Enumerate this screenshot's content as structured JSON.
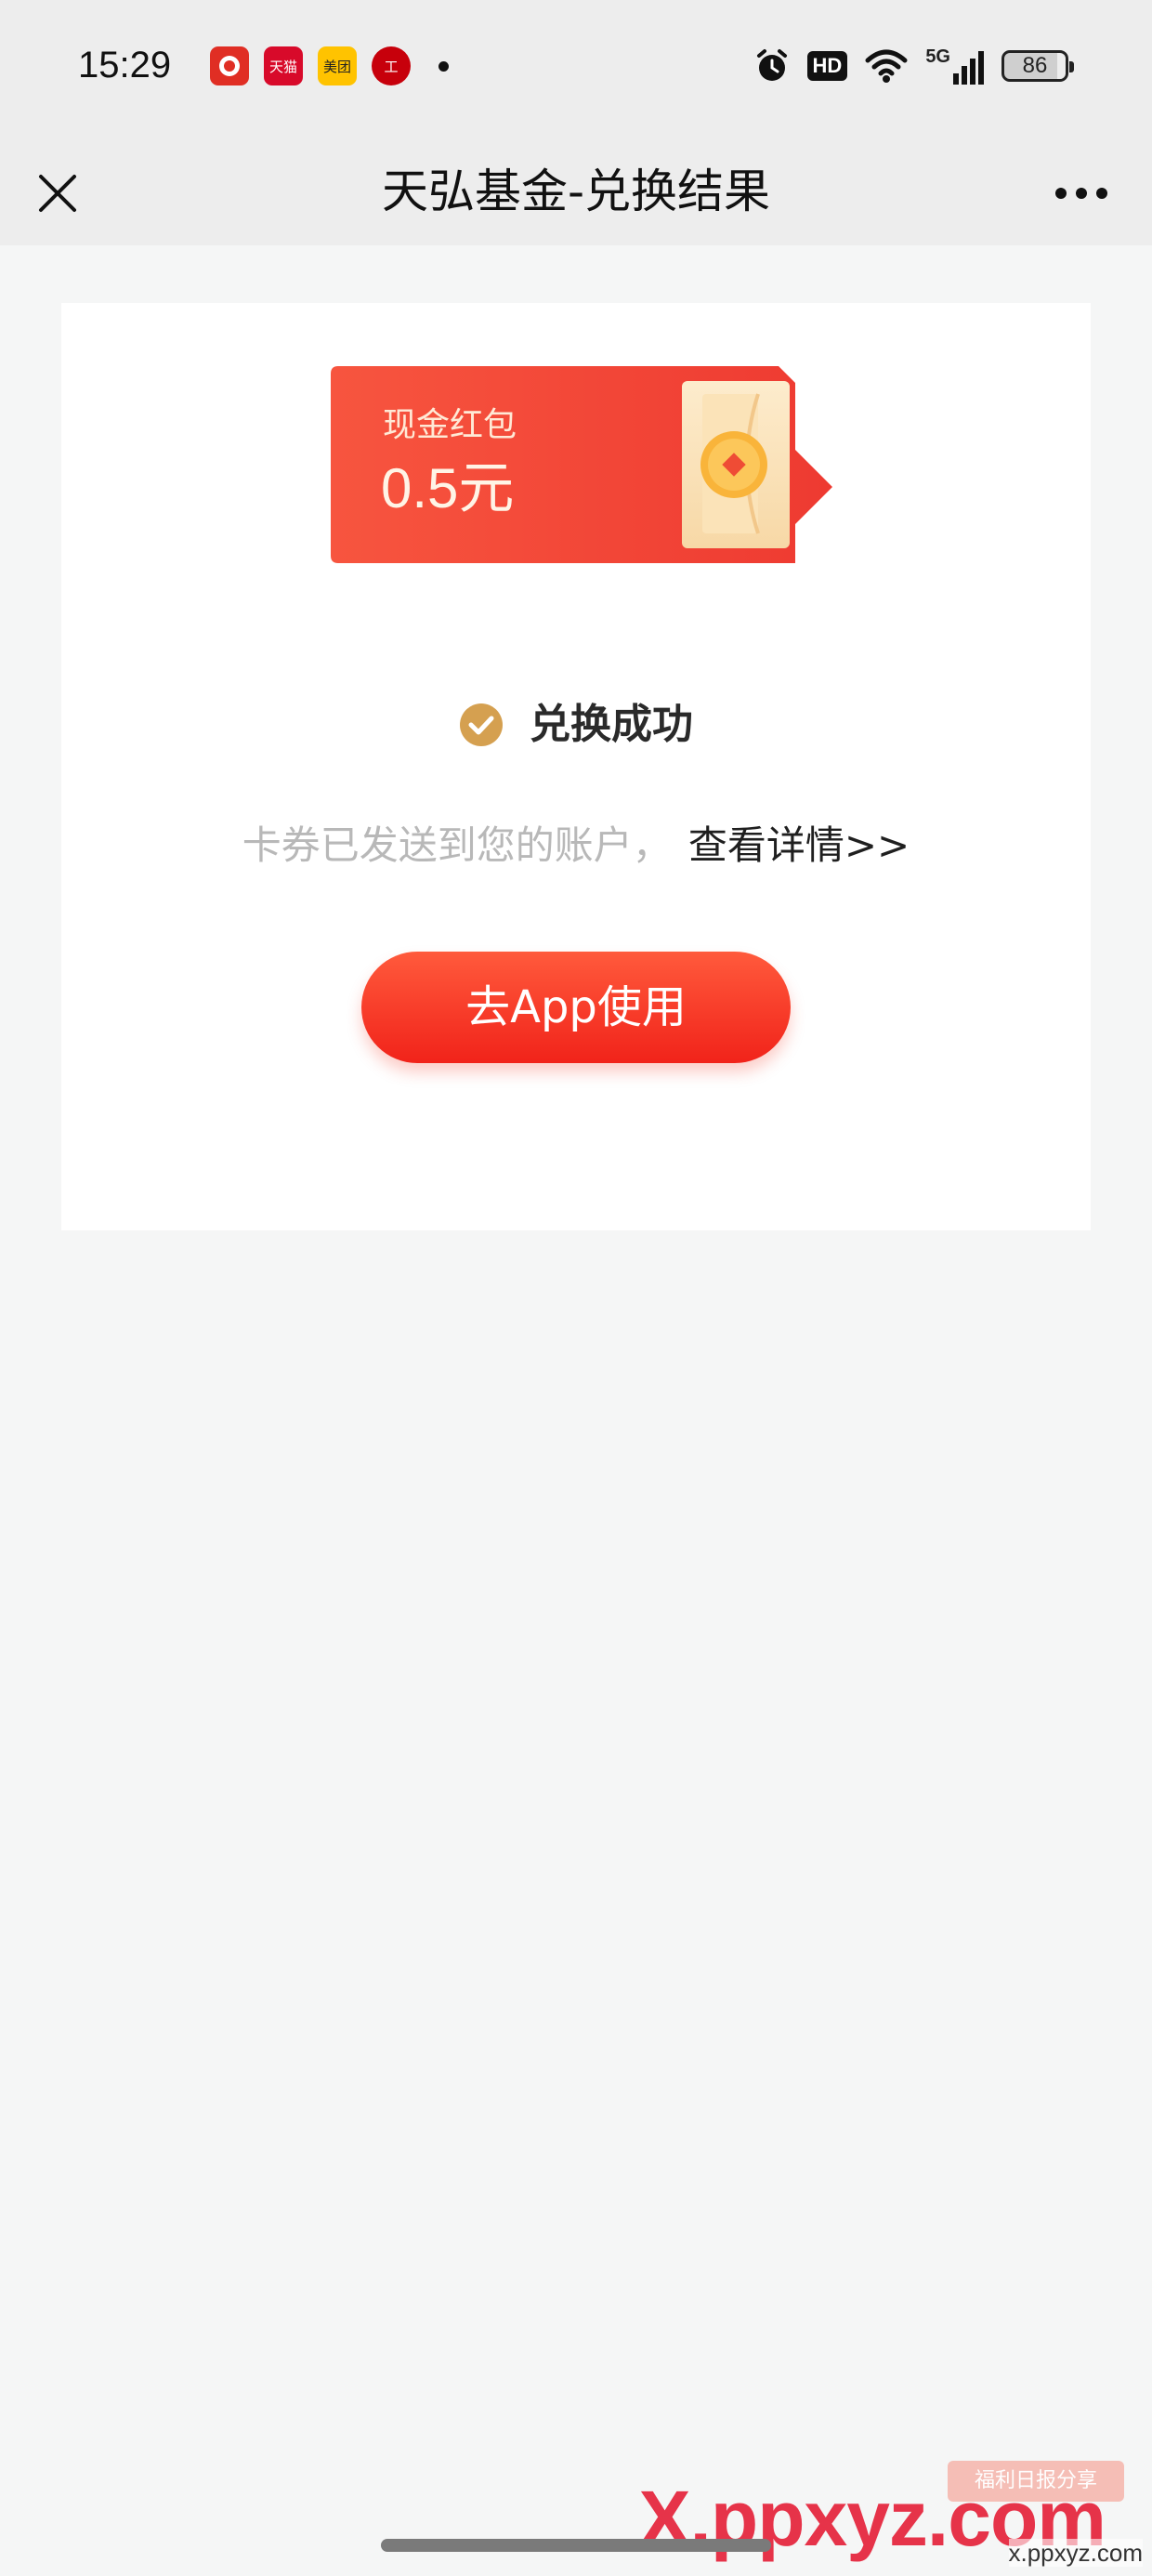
{
  "status_bar": {
    "time": "15:29",
    "notification_apps": [
      {
        "name": "pinduoduo-app-icon",
        "text": ""
      },
      {
        "name": "tmall-app-icon",
        "text": "天猫"
      },
      {
        "name": "meituan-app-icon",
        "text": "美团"
      },
      {
        "name": "icbc-app-icon",
        "text": "工"
      }
    ],
    "network": "5G",
    "hd_label": "HD",
    "battery": "86"
  },
  "title_bar": {
    "title": "天弘基金-兑换结果",
    "close_icon": "close-icon",
    "more_icon": "more-icon"
  },
  "voucher": {
    "label": "现金红包",
    "amount": "0.5元"
  },
  "result": {
    "status": "兑换成功",
    "hint": "卡券已发送到您的账户，",
    "detail_link": "查看详情>>",
    "button_label": "去App使用"
  },
  "watermark": {
    "main": "X.ppxyz.com",
    "badge": "福利日报分享",
    "small": "x.ppxyz.com"
  },
  "colors": {
    "accent_red": "#f1231a",
    "check_gold": "#d5a050",
    "voucher_red": "#f4473a"
  }
}
